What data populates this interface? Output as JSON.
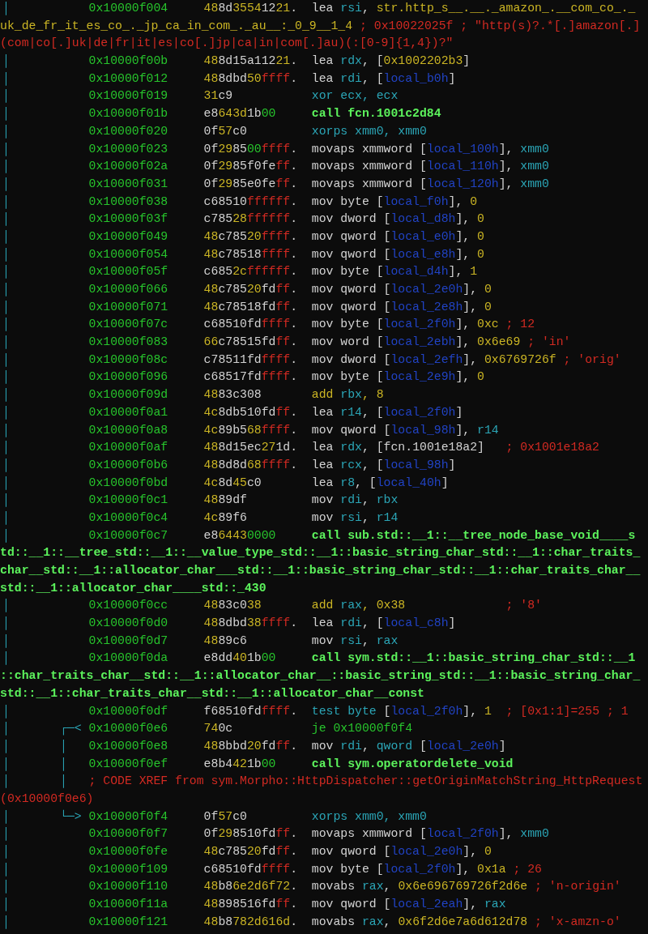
{
  "disassembly": {
    "lines": [
      {
        "kind": "insn",
        "gutter": "│",
        "address": "0x10000f004",
        "bytes": "488d35541221.",
        "parts": [
          {
            "text": "lea ",
            "kind": "plain"
          },
          {
            "text": "rsi",
            "kind": "reg"
          },
          {
            "text": ", ",
            "kind": "plain"
          },
          {
            "text": "str.http_s__.__._amazon_.__com_co_._",
            "kind": "str"
          }
        ]
      },
      {
        "kind": "wrap",
        "parts": [
          {
            "text": "uk_de_fr_it_es_co_._jp_ca_in_com_._au__:_0_9__1_4",
            "kind": "str"
          },
          {
            "text": " ; 0x10022025f ; \"http(s)?.*[.]amazon[.]",
            "kind": "comment"
          }
        ]
      },
      {
        "kind": "wrap",
        "parts": [
          {
            "text": "(com|co[.]uk|de|fr|it|es|co[.]jp|ca|in|com[.]au)(:[0-9]{1,4})?\"",
            "kind": "comment"
          }
        ]
      },
      {
        "kind": "insn",
        "gutter": "│",
        "address": "0x10000f00b",
        "bytes": "488d15a11221.",
        "parts": [
          {
            "text": "lea ",
            "kind": "plain"
          },
          {
            "text": "rdx",
            "kind": "reg"
          },
          {
            "text": ", [",
            "kind": "plain"
          },
          {
            "text": "0x1002202b3",
            "kind": "num"
          },
          {
            "text": "]",
            "kind": "plain"
          }
        ]
      },
      {
        "kind": "insn",
        "gutter": "│",
        "address": "0x10000f012",
        "bytes": "488dbd50ffff.",
        "parts": [
          {
            "text": "lea ",
            "kind": "plain"
          },
          {
            "text": "rdi",
            "kind": "reg"
          },
          {
            "text": ", [",
            "kind": "plain"
          },
          {
            "text": "local_b0h",
            "kind": "local"
          },
          {
            "text": "]",
            "kind": "plain"
          }
        ]
      },
      {
        "kind": "insn",
        "gutter": "│",
        "address": "0x10000f019",
        "bytes": "31c9",
        "parts": [
          {
            "text": "xor ecx, ecx",
            "kind": "cmp"
          }
        ]
      },
      {
        "kind": "insn",
        "gutter": "│",
        "address": "0x10000f01b",
        "bytes": "e8643d1b00",
        "parts": [
          {
            "text": "call fcn.1001c2d84",
            "kind": "call"
          }
        ]
      },
      {
        "kind": "insn",
        "gutter": "│",
        "address": "0x10000f020",
        "bytes": "0f57c0",
        "parts": [
          {
            "text": "xorps xmm0, xmm0",
            "kind": "cmp"
          }
        ]
      },
      {
        "kind": "insn",
        "gutter": "│",
        "address": "0x10000f023",
        "bytes": "0f298500ffff.",
        "parts": [
          {
            "text": "movaps xmmword [",
            "kind": "plain"
          },
          {
            "text": "local_100h",
            "kind": "local"
          },
          {
            "text": "], ",
            "kind": "plain"
          },
          {
            "text": "xmm0",
            "kind": "reg"
          }
        ]
      },
      {
        "kind": "insn",
        "gutter": "│",
        "address": "0x10000f02a",
        "bytes": "0f2985f0feff.",
        "parts": [
          {
            "text": "movaps xmmword [",
            "kind": "plain"
          },
          {
            "text": "local_110h",
            "kind": "local"
          },
          {
            "text": "], ",
            "kind": "plain"
          },
          {
            "text": "xmm0",
            "kind": "reg"
          }
        ]
      },
      {
        "kind": "insn",
        "gutter": "│",
        "address": "0x10000f031",
        "bytes": "0f2985e0feff.",
        "parts": [
          {
            "text": "movaps xmmword [",
            "kind": "plain"
          },
          {
            "text": "local_120h",
            "kind": "local"
          },
          {
            "text": "], ",
            "kind": "plain"
          },
          {
            "text": "xmm0",
            "kind": "reg"
          }
        ]
      },
      {
        "kind": "insn",
        "gutter": "│",
        "address": "0x10000f038",
        "bytes": "c68510ffffff.",
        "parts": [
          {
            "text": "mov byte [",
            "kind": "plain"
          },
          {
            "text": "local_f0h",
            "kind": "local"
          },
          {
            "text": "], ",
            "kind": "plain"
          },
          {
            "text": "0",
            "kind": "num"
          }
        ]
      },
      {
        "kind": "insn",
        "gutter": "│",
        "address": "0x10000f03f",
        "bytes": "c78528ffffff.",
        "parts": [
          {
            "text": "mov dword [",
            "kind": "plain"
          },
          {
            "text": "local_d8h",
            "kind": "local"
          },
          {
            "text": "], ",
            "kind": "plain"
          },
          {
            "text": "0",
            "kind": "num"
          }
        ]
      },
      {
        "kind": "insn",
        "gutter": "│",
        "address": "0x10000f049",
        "bytes": "48c78520ffff.",
        "parts": [
          {
            "text": "mov qword [",
            "kind": "plain"
          },
          {
            "text": "local_e0h",
            "kind": "local"
          },
          {
            "text": "], ",
            "kind": "plain"
          },
          {
            "text": "0",
            "kind": "num"
          }
        ]
      },
      {
        "kind": "insn",
        "gutter": "│",
        "address": "0x10000f054",
        "bytes": "48c78518ffff.",
        "parts": [
          {
            "text": "mov qword [",
            "kind": "plain"
          },
          {
            "text": "local_e8h",
            "kind": "local"
          },
          {
            "text": "], ",
            "kind": "plain"
          },
          {
            "text": "0",
            "kind": "num"
          }
        ]
      },
      {
        "kind": "insn",
        "gutter": "│",
        "address": "0x10000f05f",
        "bytes": "c6852cffffff.",
        "parts": [
          {
            "text": "mov byte [",
            "kind": "plain"
          },
          {
            "text": "local_d4h",
            "kind": "local"
          },
          {
            "text": "], ",
            "kind": "plain"
          },
          {
            "text": "1",
            "kind": "num"
          }
        ]
      },
      {
        "kind": "insn",
        "gutter": "│",
        "address": "0x10000f066",
        "bytes": "48c78520fdff.",
        "parts": [
          {
            "text": "mov qword [",
            "kind": "plain"
          },
          {
            "text": "local_2e0h",
            "kind": "local"
          },
          {
            "text": "], ",
            "kind": "plain"
          },
          {
            "text": "0",
            "kind": "num"
          }
        ]
      },
      {
        "kind": "insn",
        "gutter": "│",
        "address": "0x10000f071",
        "bytes": "48c78518fdff.",
        "parts": [
          {
            "text": "mov qword [",
            "kind": "plain"
          },
          {
            "text": "local_2e8h",
            "kind": "local"
          },
          {
            "text": "], ",
            "kind": "plain"
          },
          {
            "text": "0",
            "kind": "num"
          }
        ]
      },
      {
        "kind": "insn",
        "gutter": "│",
        "address": "0x10000f07c",
        "bytes": "c68510fdffff.",
        "parts": [
          {
            "text": "mov byte [",
            "kind": "plain"
          },
          {
            "text": "local_2f0h",
            "kind": "local"
          },
          {
            "text": "], ",
            "kind": "plain"
          },
          {
            "text": "0xc",
            "kind": "num"
          },
          {
            "text": " ; 12",
            "kind": "comment"
          }
        ]
      },
      {
        "kind": "insn",
        "gutter": "│",
        "address": "0x10000f083",
        "bytes": "66c78515fdff.",
        "parts": [
          {
            "text": "mov word [",
            "kind": "plain"
          },
          {
            "text": "local_2ebh",
            "kind": "local"
          },
          {
            "text": "], ",
            "kind": "plain"
          },
          {
            "text": "0x6e69",
            "kind": "num"
          },
          {
            "text": " ; 'in'",
            "kind": "comment"
          }
        ]
      },
      {
        "kind": "insn",
        "gutter": "│",
        "address": "0x10000f08c",
        "bytes": "c78511fdffff.",
        "parts": [
          {
            "text": "mov dword [",
            "kind": "plain"
          },
          {
            "text": "local_2efh",
            "kind": "local"
          },
          {
            "text": "], ",
            "kind": "plain"
          },
          {
            "text": "0x6769726f",
            "kind": "num"
          },
          {
            "text": " ; 'orig'",
            "kind": "comment"
          }
        ]
      },
      {
        "kind": "insn",
        "gutter": "│",
        "address": "0x10000f096",
        "bytes": "c68517fdffff.",
        "parts": [
          {
            "text": "mov byte [",
            "kind": "plain"
          },
          {
            "text": "local_2e9h",
            "kind": "local"
          },
          {
            "text": "], ",
            "kind": "plain"
          },
          {
            "text": "0",
            "kind": "num"
          }
        ]
      },
      {
        "kind": "insn",
        "gutter": "│",
        "address": "0x10000f09d",
        "bytes": "4883c308",
        "parts": [
          {
            "text": "add ",
            "kind": "math"
          },
          {
            "text": "rbx",
            "kind": "reg"
          },
          {
            "text": ", 8",
            "kind": "math"
          }
        ]
      },
      {
        "kind": "insn",
        "gutter": "│",
        "address": "0x10000f0a1",
        "bytes": "4c8db510fdff.",
        "parts": [
          {
            "text": "lea ",
            "kind": "plain"
          },
          {
            "text": "r14",
            "kind": "reg"
          },
          {
            "text": ", [",
            "kind": "plain"
          },
          {
            "text": "local_2f0h",
            "kind": "local"
          },
          {
            "text": "]",
            "kind": "plain"
          }
        ]
      },
      {
        "kind": "insn",
        "gutter": "│",
        "address": "0x10000f0a8",
        "bytes": "4c89b568ffff.",
        "parts": [
          {
            "text": "mov qword [",
            "kind": "plain"
          },
          {
            "text": "local_98h",
            "kind": "local"
          },
          {
            "text": "], ",
            "kind": "plain"
          },
          {
            "text": "r14",
            "kind": "reg"
          }
        ]
      },
      {
        "kind": "insn",
        "gutter": "│",
        "address": "0x10000f0af",
        "bytes": "488d15ec271d.",
        "parts": [
          {
            "text": "lea ",
            "kind": "plain"
          },
          {
            "text": "rdx",
            "kind": "reg"
          },
          {
            "text": ", [fcn.1001e18a2]   ",
            "kind": "plain"
          },
          {
            "text": "; 0x1001e18a2",
            "kind": "comment"
          }
        ]
      },
      {
        "kind": "insn",
        "gutter": "│",
        "address": "0x10000f0b6",
        "bytes": "488d8d68ffff.",
        "parts": [
          {
            "text": "lea ",
            "kind": "plain"
          },
          {
            "text": "rcx",
            "kind": "reg"
          },
          {
            "text": ", [",
            "kind": "plain"
          },
          {
            "text": "local_98h",
            "kind": "local"
          },
          {
            "text": "]",
            "kind": "plain"
          }
        ]
      },
      {
        "kind": "insn",
        "gutter": "│",
        "address": "0x10000f0bd",
        "bytes": "4c8d45c0",
        "parts": [
          {
            "text": "lea ",
            "kind": "plain"
          },
          {
            "text": "r8",
            "kind": "reg"
          },
          {
            "text": ", [",
            "kind": "plain"
          },
          {
            "text": "local_40h",
            "kind": "local"
          },
          {
            "text": "]",
            "kind": "plain"
          }
        ]
      },
      {
        "kind": "insn",
        "gutter": "│",
        "address": "0x10000f0c1",
        "bytes": "4889df",
        "parts": [
          {
            "text": "mov ",
            "kind": "plain"
          },
          {
            "text": "rdi",
            "kind": "reg"
          },
          {
            "text": ", ",
            "kind": "plain"
          },
          {
            "text": "rbx",
            "kind": "reg"
          }
        ]
      },
      {
        "kind": "insn",
        "gutter": "│",
        "address": "0x10000f0c4",
        "bytes": "4c89f6",
        "parts": [
          {
            "text": "mov ",
            "kind": "plain"
          },
          {
            "text": "rsi",
            "kind": "reg"
          },
          {
            "text": ", ",
            "kind": "plain"
          },
          {
            "text": "r14",
            "kind": "reg"
          }
        ]
      },
      {
        "kind": "insn",
        "gutter": "│",
        "address": "0x10000f0c7",
        "bytes": "e864430000",
        "parts": [
          {
            "text": "call sub.std::__1::__tree_node_base_void____s",
            "kind": "call"
          }
        ]
      },
      {
        "kind": "wrap",
        "parts": [
          {
            "text": "td::__1::__tree_std::__1::__value_type_std::__1::basic_string_char_std::__1::char_traits_",
            "kind": "call"
          }
        ]
      },
      {
        "kind": "wrap",
        "parts": [
          {
            "text": "char__std::__1::allocator_char___std::__1::basic_string_char_std::__1::char_traits_char__",
            "kind": "call"
          }
        ]
      },
      {
        "kind": "wrap",
        "parts": [
          {
            "text": "std::__1::allocator_char____std::_430",
            "kind": "call"
          }
        ]
      },
      {
        "kind": "insn",
        "gutter": "│",
        "address": "0x10000f0cc",
        "bytes": "4883c038",
        "parts": [
          {
            "text": "add ",
            "kind": "math"
          },
          {
            "text": "rax",
            "kind": "reg"
          },
          {
            "text": ", 0x38              ",
            "kind": "math"
          },
          {
            "text": "; '8'",
            "kind": "comment"
          }
        ]
      },
      {
        "kind": "insn",
        "gutter": "│",
        "address": "0x10000f0d0",
        "bytes": "488dbd38ffff.",
        "parts": [
          {
            "text": "lea ",
            "kind": "plain"
          },
          {
            "text": "rdi",
            "kind": "reg"
          },
          {
            "text": ", [",
            "kind": "plain"
          },
          {
            "text": "local_c8h",
            "kind": "local"
          },
          {
            "text": "]",
            "kind": "plain"
          }
        ]
      },
      {
        "kind": "insn",
        "gutter": "│",
        "address": "0x10000f0d7",
        "bytes": "4889c6",
        "parts": [
          {
            "text": "mov ",
            "kind": "plain"
          },
          {
            "text": "rsi",
            "kind": "reg"
          },
          {
            "text": ", ",
            "kind": "plain"
          },
          {
            "text": "rax",
            "kind": "reg"
          }
        ]
      },
      {
        "kind": "insn",
        "gutter": "│",
        "address": "0x10000f0da",
        "bytes": "e8dd401b00",
        "parts": [
          {
            "text": "call sym.std::__1::basic_string_char_std::__1",
            "kind": "call"
          }
        ]
      },
      {
        "kind": "wrap",
        "parts": [
          {
            "text": "::char_traits_char__std::__1::allocator_char__::basic_string_std::__1::basic_string_char_",
            "kind": "call"
          }
        ]
      },
      {
        "kind": "wrap",
        "parts": [
          {
            "text": "std::__1::char_traits_char__std::__1::allocator_char__const",
            "kind": "call"
          }
        ]
      },
      {
        "kind": "insn",
        "gutter": "│",
        "address": "0x10000f0df",
        "bytes": "f68510fdffff.",
        "parts": [
          {
            "text": "test byte ",
            "kind": "cmp"
          },
          {
            "text": "[",
            "kind": "plain"
          },
          {
            "text": "local_2f0h",
            "kind": "local"
          },
          {
            "text": "], ",
            "kind": "plain"
          },
          {
            "text": "1",
            "kind": "num"
          },
          {
            "text": "  ; [0x1:1]=255 ; 1",
            "kind": "comment"
          }
        ]
      },
      {
        "kind": "insn",
        "gutter": "│       ┌─<",
        "address": "0x10000f0e6",
        "bytes": "740c",
        "parts": [
          {
            "text": "je 0x10000f0f4",
            "kind": "jump"
          }
        ]
      },
      {
        "kind": "insn",
        "gutter": "│       │",
        "address": "0x10000f0e8",
        "bytes": "488bbd20fdff.",
        "parts": [
          {
            "text": "mov ",
            "kind": "plain"
          },
          {
            "text": "rdi",
            "kind": "reg"
          },
          {
            "text": ", ",
            "kind": "plain"
          },
          {
            "text": "qword",
            "kind": "reg"
          },
          {
            "text": " [",
            "kind": "plain"
          },
          {
            "text": "local_2e0h",
            "kind": "local"
          },
          {
            "text": "]",
            "kind": "plain"
          }
        ]
      },
      {
        "kind": "insn",
        "gutter": "│       │",
        "address": "0x10000f0ef",
        "bytes": "e8b4421b00",
        "parts": [
          {
            "text": "call sym.operatordelete_void",
            "kind": "call"
          }
        ]
      },
      {
        "kind": "xref",
        "gutter": "│       │",
        "parts": [
          {
            "text": "; CODE XREF from sym.Morpho::HttpDispatcher::getOriginMatchString_HttpRequest",
            "kind": "comment"
          }
        ]
      },
      {
        "kind": "wrap",
        "parts": [
          {
            "text": "(0x10000f0e6)",
            "kind": "comment"
          }
        ]
      },
      {
        "kind": "insn",
        "gutter": "│       └─>",
        "address": "0x10000f0f4",
        "bytes": "0f57c0",
        "parts": [
          {
            "text": "xorps xmm0, xmm0",
            "kind": "cmp"
          }
        ]
      },
      {
        "kind": "insn",
        "gutter": "│",
        "address": "0x10000f0f7",
        "bytes": "0f298510fdff.",
        "parts": [
          {
            "text": "movaps xmmword [",
            "kind": "plain"
          },
          {
            "text": "local_2f0h",
            "kind": "local"
          },
          {
            "text": "], ",
            "kind": "plain"
          },
          {
            "text": "xmm0",
            "kind": "reg"
          }
        ]
      },
      {
        "kind": "insn",
        "gutter": "│",
        "address": "0x10000f0fe",
        "bytes": "48c78520fdff.",
        "parts": [
          {
            "text": "mov qword [",
            "kind": "plain"
          },
          {
            "text": "local_2e0h",
            "kind": "local"
          },
          {
            "text": "], ",
            "kind": "plain"
          },
          {
            "text": "0",
            "kind": "num"
          }
        ]
      },
      {
        "kind": "insn",
        "gutter": "│",
        "address": "0x10000f109",
        "bytes": "c68510fdffff.",
        "parts": [
          {
            "text": "mov byte [",
            "kind": "plain"
          },
          {
            "text": "local_2f0h",
            "kind": "local"
          },
          {
            "text": "], ",
            "kind": "plain"
          },
          {
            "text": "0x1a",
            "kind": "num"
          },
          {
            "text": " ; 26",
            "kind": "comment"
          }
        ]
      },
      {
        "kind": "insn",
        "gutter": "│",
        "address": "0x10000f110",
        "bytes": "48b86e2d6f72.",
        "parts": [
          {
            "text": "movabs ",
            "kind": "plain"
          },
          {
            "text": "rax",
            "kind": "reg"
          },
          {
            "text": ", ",
            "kind": "plain"
          },
          {
            "text": "0x6e696769726f2d6e",
            "kind": "num"
          },
          {
            "text": " ; 'n-origin'",
            "kind": "comment"
          }
        ]
      },
      {
        "kind": "insn",
        "gutter": "│",
        "address": "0x10000f11a",
        "bytes": "48898516fdff.",
        "parts": [
          {
            "text": "mov qword [",
            "kind": "plain"
          },
          {
            "text": "local_2eah",
            "kind": "local"
          },
          {
            "text": "], ",
            "kind": "plain"
          },
          {
            "text": "rax",
            "kind": "reg"
          }
        ]
      },
      {
        "kind": "insn",
        "gutter": "│",
        "address": "0x10000f121",
        "bytes": "48b8782d616d.",
        "parts": [
          {
            "text": "movabs ",
            "kind": "plain"
          },
          {
            "text": "rax",
            "kind": "reg"
          },
          {
            "text": ", ",
            "kind": "plain"
          },
          {
            "text": "0x6f2d6e7a6d612d78",
            "kind": "num"
          },
          {
            "text": " ; 'x-amzn-o'",
            "kind": "comment"
          }
        ]
      }
    ]
  }
}
